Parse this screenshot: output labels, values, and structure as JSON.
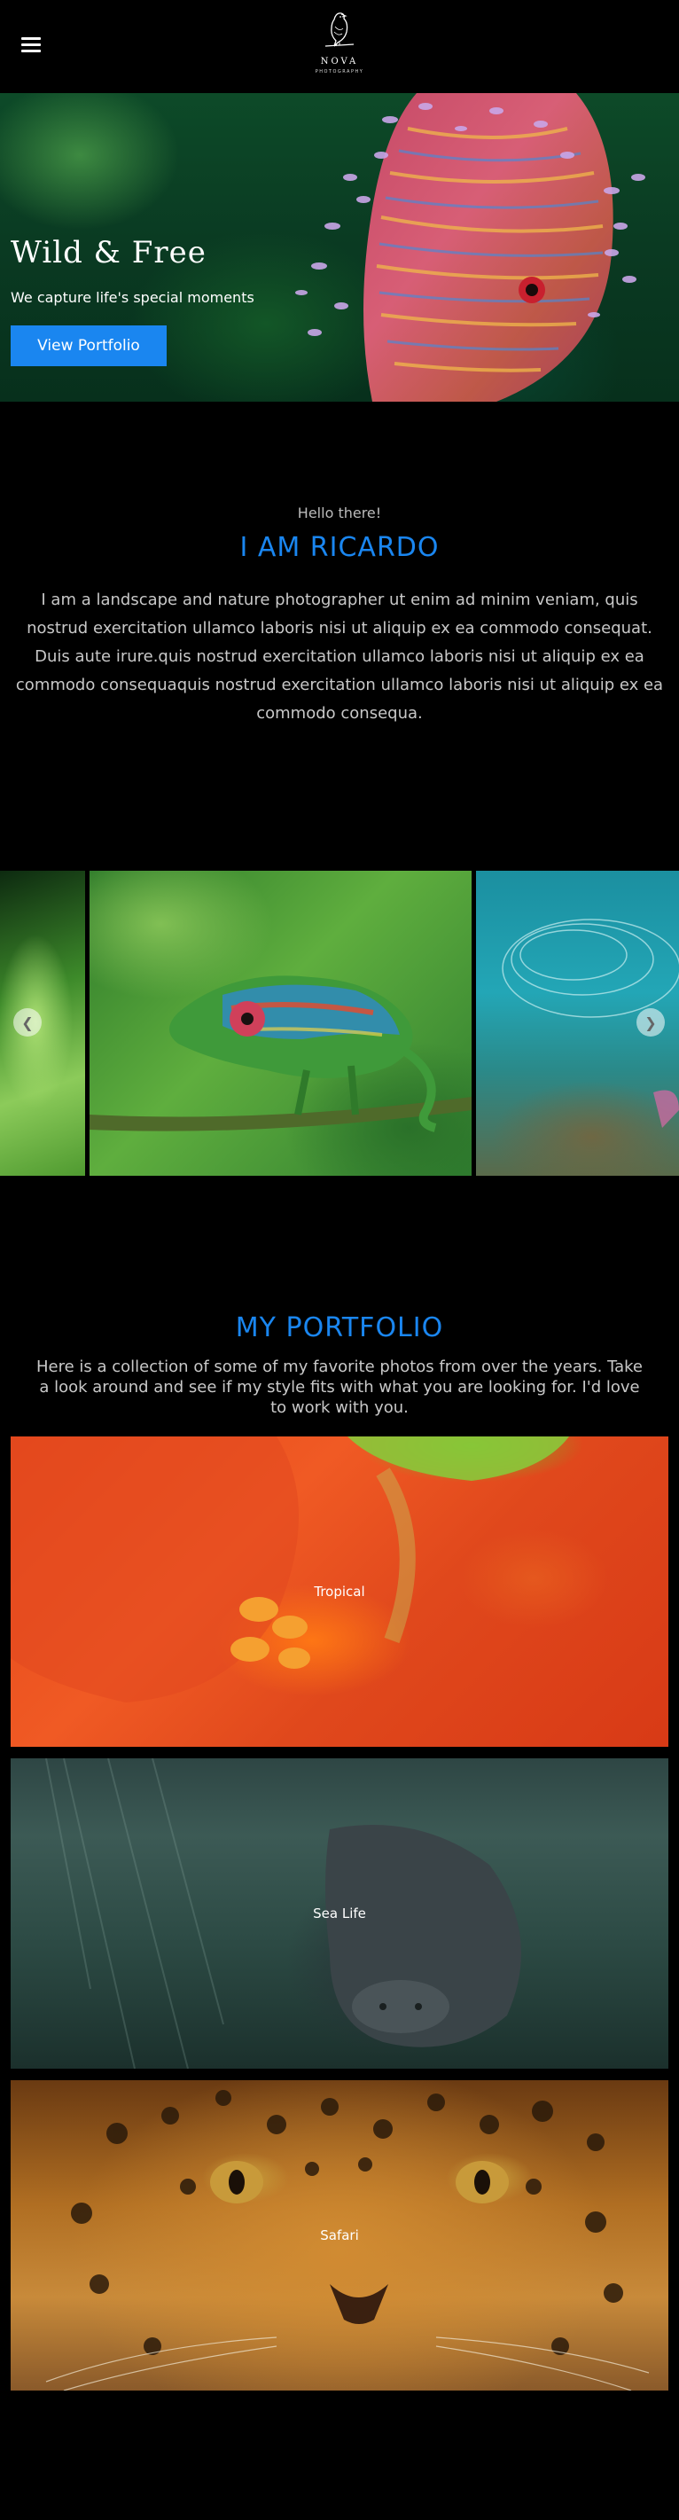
{
  "header": {
    "menu_icon": "hamburger-menu-icon",
    "logo_icon": "bird-logo-icon",
    "logo_name": "NOVA",
    "logo_sub": "PHOTOGRAPHY"
  },
  "hero": {
    "title": "Wild & Free",
    "subtitle": "We capture life's special moments",
    "button_label": "View Portfolio"
  },
  "about": {
    "greeting": "Hello there!",
    "title": "I AM RICARDO",
    "text": "I am a landscape and nature photographer ut enim ad minim veniam, quis nostrud exercitation ullamco laboris nisi ut aliquip ex ea commodo consequat. Duis aute irure.quis nostrud exercitation ullamco laboris nisi ut aliquip ex ea commodo consequaquis nostrud exercitation ullamco laboris nisi ut aliquip ex ea commodo consequa."
  },
  "carousel": {
    "prev_icon": "chevron-left-icon",
    "next_icon": "chevron-right-icon"
  },
  "portfolio": {
    "title": "MY PORTFOLIO",
    "text": "Here is a collection of some of my favorite photos from over the years. Take a look around and see if my style fits with what you are looking for. I'd love to work with you.",
    "items": [
      {
        "label": "Tropical"
      },
      {
        "label": "Sea Life"
      },
      {
        "label": "Safari"
      }
    ]
  },
  "colors": {
    "accent": "#1a86f0",
    "background": "#000000",
    "body_text": "#c8c8c8"
  }
}
